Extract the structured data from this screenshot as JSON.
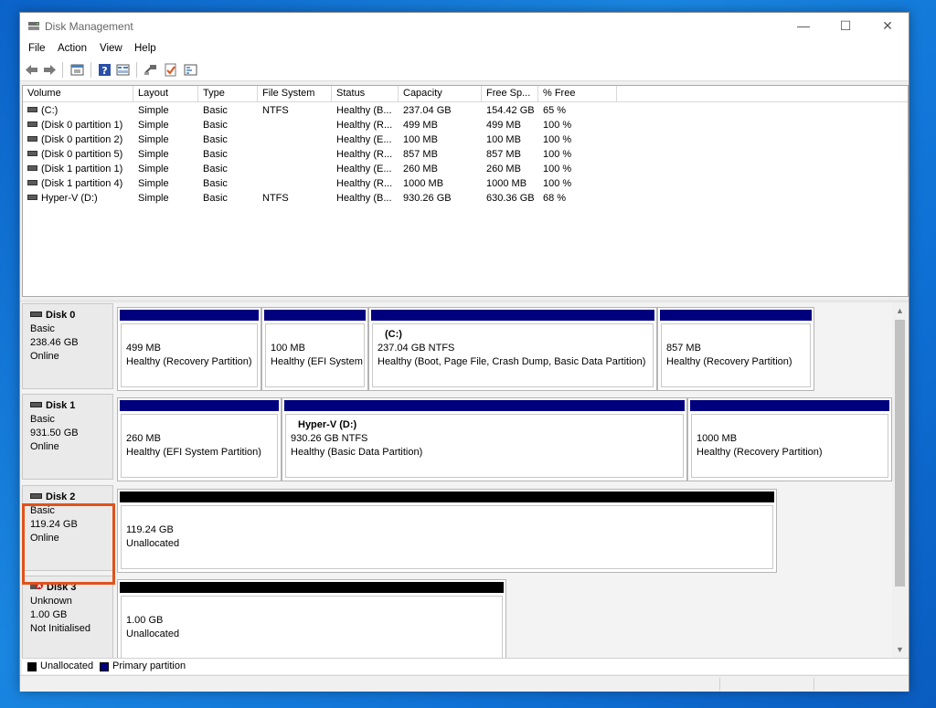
{
  "window": {
    "title": "Disk Management",
    "controls": {
      "minimize": "—",
      "maximize": "☐",
      "close": "✕"
    }
  },
  "menu": [
    "File",
    "Action",
    "View",
    "Help"
  ],
  "toolbar": {
    "buttons": [
      "back-icon",
      "forward-icon",
      "properties-icon",
      "help-icon",
      "details-view-icon",
      "connect-icon",
      "check-icon",
      "list-icon"
    ]
  },
  "volume_list": {
    "columns": [
      "Volume",
      "Layout",
      "Type",
      "File System",
      "Status",
      "Capacity",
      "Free Sp...",
      "% Free"
    ],
    "rows": [
      [
        "(C:)",
        "Simple",
        "Basic",
        "NTFS",
        "Healthy (B...",
        "237.04 GB",
        "154.42 GB",
        "65 %"
      ],
      [
        "(Disk 0 partition 1)",
        "Simple",
        "Basic",
        "",
        "Healthy (R...",
        "499 MB",
        "499 MB",
        "100 %"
      ],
      [
        "(Disk 0 partition 2)",
        "Simple",
        "Basic",
        "",
        "Healthy (E...",
        "100 MB",
        "100 MB",
        "100 %"
      ],
      [
        "(Disk 0 partition 5)",
        "Simple",
        "Basic",
        "",
        "Healthy (R...",
        "857 MB",
        "857 MB",
        "100 %"
      ],
      [
        "(Disk 1 partition 1)",
        "Simple",
        "Basic",
        "",
        "Healthy (E...",
        "260 MB",
        "260 MB",
        "100 %"
      ],
      [
        "(Disk 1 partition 4)",
        "Simple",
        "Basic",
        "",
        "Healthy (R...",
        "1000 MB",
        "1000 MB",
        "100 %"
      ],
      [
        "Hyper-V (D:)",
        "Simple",
        "Basic",
        "NTFS",
        "Healthy (B...",
        "930.26 GB",
        "630.36 GB",
        "68 %"
      ]
    ]
  },
  "disks": [
    {
      "name": "Disk 0",
      "kind": "Basic",
      "size": "238.46 GB",
      "state": "Online",
      "partitions": [
        {
          "label": "",
          "size": "499 MB",
          "status": "Healthy (Recovery Partition)",
          "bar": "primary"
        },
        {
          "label": "",
          "size": "100 MB",
          "status": "Healthy (EFI System",
          "bar": "primary"
        },
        {
          "label": "(C:)",
          "size": "237.04 GB NTFS",
          "status": "Healthy (Boot, Page File, Crash Dump, Basic Data Partition)",
          "bar": "primary"
        },
        {
          "label": "",
          "size": "857 MB",
          "status": "Healthy (Recovery Partition)",
          "bar": "primary"
        }
      ]
    },
    {
      "name": "Disk 1",
      "kind": "Basic",
      "size": "931.50 GB",
      "state": "Online",
      "partitions": [
        {
          "label": "",
          "size": "260 MB",
          "status": "Healthy (EFI System Partition)",
          "bar": "primary"
        },
        {
          "label": "Hyper-V  (D:)",
          "size": "930.26 GB NTFS",
          "status": "Healthy (Basic Data Partition)",
          "bar": "primary"
        },
        {
          "label": "",
          "size": "1000 MB",
          "status": "Healthy (Recovery Partition)",
          "bar": "primary"
        }
      ]
    },
    {
      "name": "Disk 2",
      "kind": "Basic",
      "size": "119.24 GB",
      "state": "Online",
      "partitions": [
        {
          "label": "",
          "size": "119.24 GB",
          "status": "Unallocated",
          "bar": "unallocated"
        }
      ]
    },
    {
      "name": "Disk 3",
      "kind": "Unknown",
      "size": "1.00 GB",
      "state": "Not Initialised",
      "partitions": [
        {
          "label": "",
          "size": "1.00 GB",
          "status": "Unallocated",
          "bar": "unallocated"
        }
      ]
    }
  ],
  "legend": [
    {
      "label": "Unallocated",
      "color": "#000000"
    },
    {
      "label": "Primary partition",
      "color": "#00007f"
    }
  ],
  "colors": {
    "primary_bar": "#00007f",
    "unallocated_bar": "#000000",
    "highlight": "#e0521b"
  }
}
